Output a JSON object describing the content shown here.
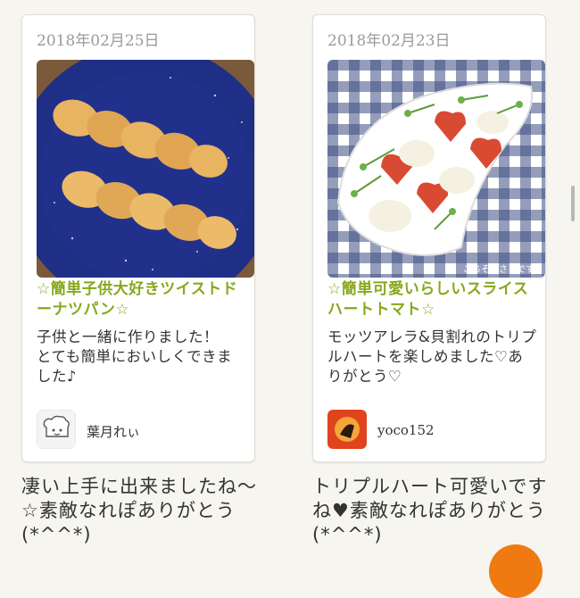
{
  "cards": [
    {
      "date": "2018年02月25日",
      "title": "☆簡単子供大好きツイストドーナツパン☆",
      "description": "子供と一緒に作りました！\nとても簡単においしくできました♪",
      "author": "葉月れぃ",
      "photo": "twisted-donut-photo",
      "avatar_icon": "chef-hat-icon"
    },
    {
      "date": "2018年02月23日",
      "title": "☆簡単可愛いらしいスライスハートトマト☆",
      "description": "モッツアレラ&貝割れのトリプルハートを楽しめました♡ありがとう♡",
      "author": "yoco152",
      "photo": "caprese-salad-photo",
      "photo_caption": "ごちそうさまです",
      "avatar_icon": "user-avatar"
    }
  ],
  "comments": [
    "凄い上手に出来ましたね〜☆素敵なれぽありがとう(*^^*)",
    "トリプルハート可愛いですね♥素敵なれぽありがとう(*^^*)"
  ],
  "colors": {
    "title_green": "#86a81d",
    "fab_orange": "#f07a12",
    "background": "#f6f5ef"
  }
}
